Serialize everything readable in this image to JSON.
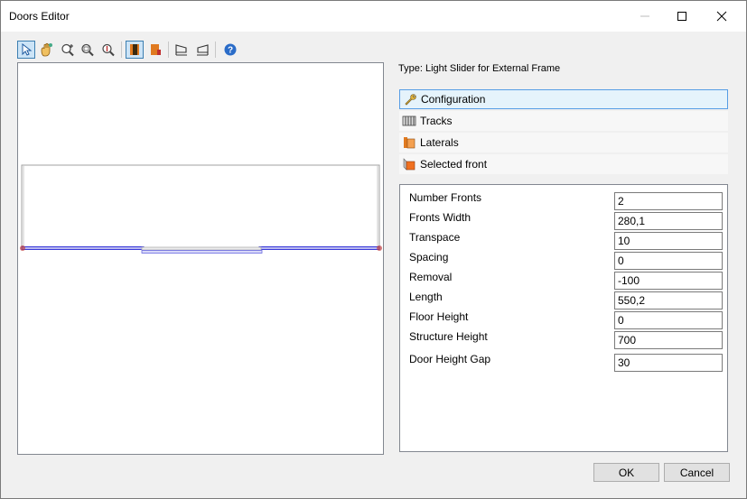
{
  "window": {
    "title": "Doors Editor"
  },
  "toolbar": {
    "tools": [
      {
        "name": "pointer-tool-icon"
      },
      {
        "name": "pan-tool-icon"
      },
      {
        "name": "zoom-in-tool-icon"
      },
      {
        "name": "zoom-fit-tool-icon"
      },
      {
        "name": "zoom-out-tool-icon"
      },
      {
        "name": "front-view-icon"
      },
      {
        "name": "side-view-icon"
      },
      {
        "name": "view-left-icon"
      },
      {
        "name": "view-right-icon"
      },
      {
        "name": "help-icon"
      }
    ]
  },
  "type_label": "Type: Light Slider for External Frame",
  "sections": [
    {
      "label": "Configuration",
      "icon": "wrench-icon",
      "selected": true
    },
    {
      "label": "Tracks",
      "icon": "tracks-icon",
      "selected": false
    },
    {
      "label": "Laterals",
      "icon": "laterals-icon",
      "selected": false
    },
    {
      "label": "Selected front",
      "icon": "front-icon",
      "selected": false
    }
  ],
  "properties": [
    {
      "label": "Number Fronts",
      "value": "2"
    },
    {
      "label": "Fronts Width",
      "value": "280,1"
    },
    {
      "label": "Transpace",
      "value": "10"
    },
    {
      "label": "Spacing",
      "value": "0"
    },
    {
      "label": "Removal",
      "value": "-100"
    },
    {
      "label": "Length",
      "value": "550,2"
    },
    {
      "label": "Floor Height",
      "value": "0"
    },
    {
      "label": "Structure Height",
      "value": "700"
    },
    {
      "label": "Door Height Gap",
      "value": "30"
    }
  ],
  "buttons": {
    "ok": "OK",
    "cancel": "Cancel"
  },
  "colors": {
    "accent": "#569de5",
    "track_line": "#3a3ad8",
    "track_fill": "#b8b8f0",
    "end_marker": "#c04040"
  }
}
